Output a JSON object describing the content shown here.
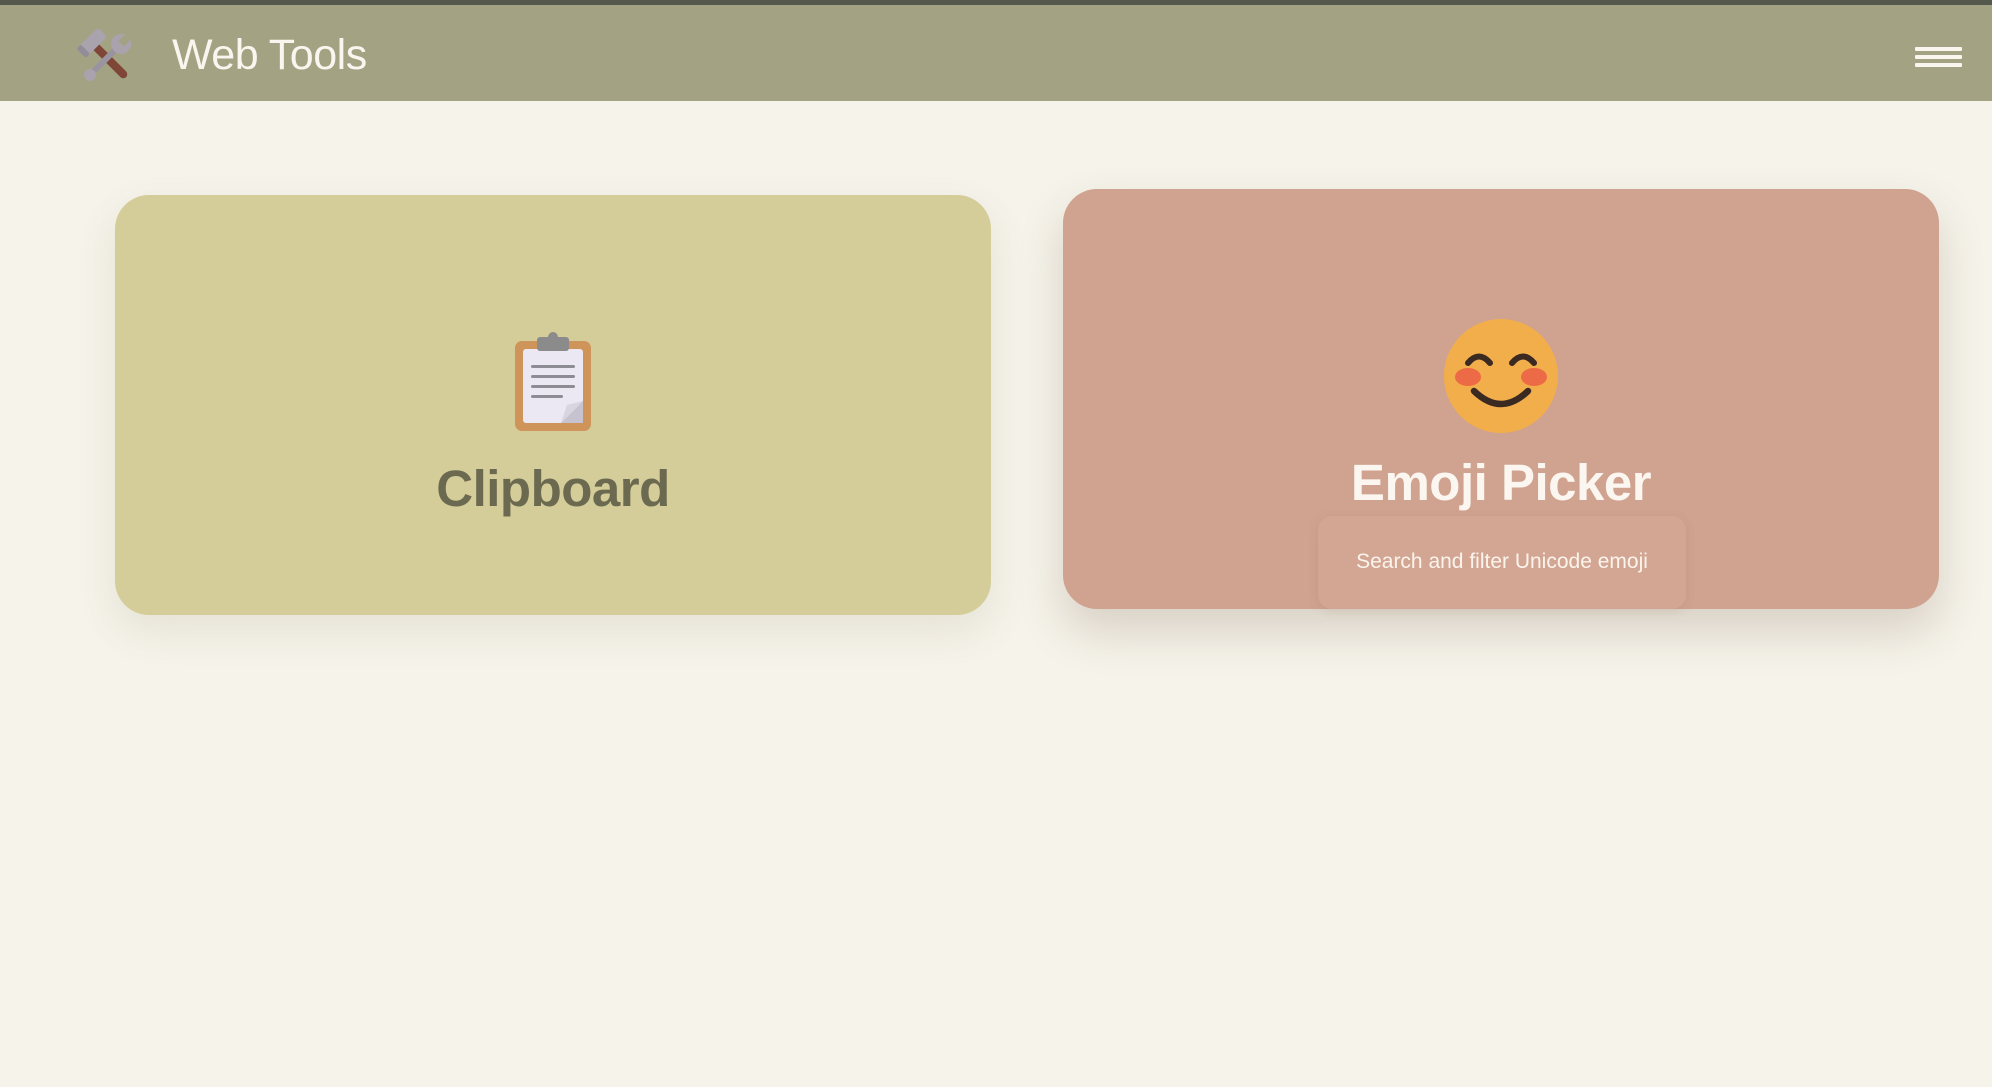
{
  "app": {
    "title": "Web Tools",
    "logo_icon": "hammer-and-wrench-icon",
    "menu_icon": "hamburger-menu-icon"
  },
  "colors": {
    "header_bg": "#a3a383",
    "page_bg": "#f5f3ea",
    "clipboard_card_bg": "#d5cd99",
    "emoji_card_bg": "#d0a290",
    "header_text": "#f8f6ee"
  },
  "tools": [
    {
      "title": "Clipboard",
      "icon": "clipboard-icon",
      "description": ""
    },
    {
      "title": "Emoji Picker",
      "icon": "smiling-face-emoji-icon",
      "description": "Search and filter Unicode emoji"
    }
  ]
}
